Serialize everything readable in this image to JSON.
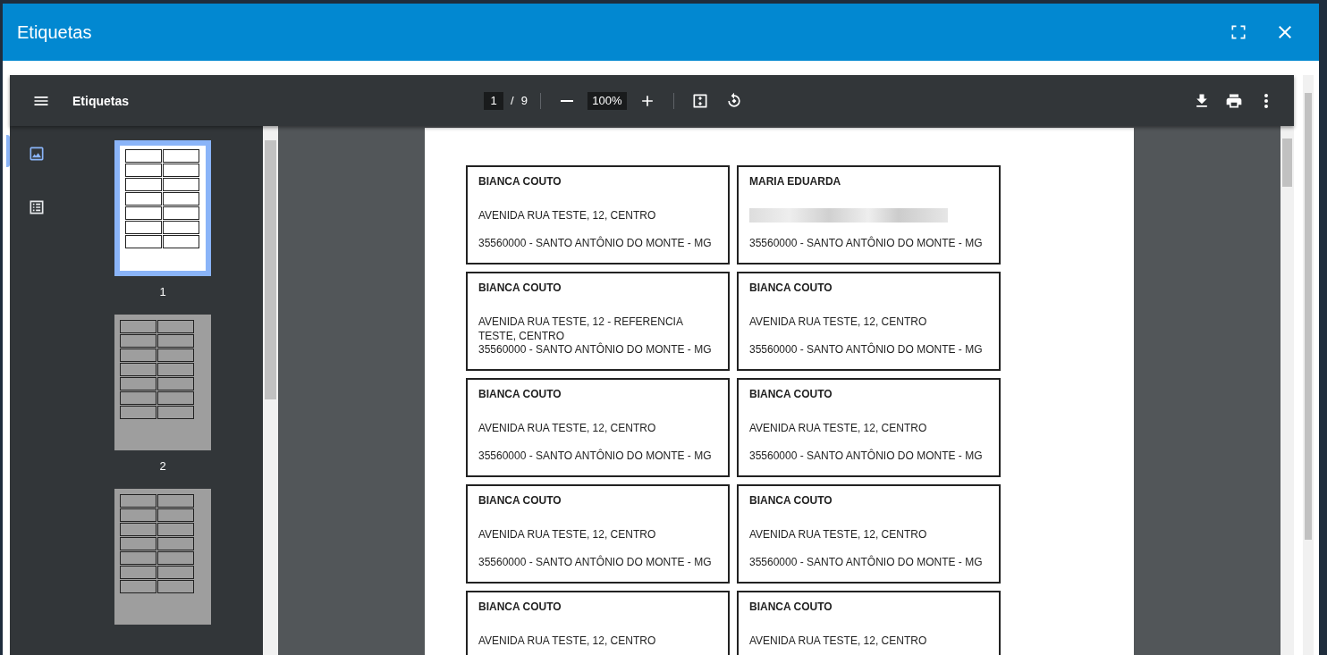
{
  "dialog": {
    "title": "Etiquetas"
  },
  "viewer": {
    "title": "Etiquetas",
    "page": "1",
    "page_separator": "/",
    "page_count": "9",
    "zoom": "100%"
  },
  "sidebar_tabs": [
    {
      "kind": "thumbnails",
      "selected": true
    },
    {
      "kind": "outline",
      "selected": false
    }
  ],
  "thumbnails": [
    {
      "label": "1",
      "selected": true
    },
    {
      "label": "2",
      "selected": false
    },
    {
      "selected": false
    }
  ],
  "labels": [
    {
      "name": "BIANCA COUTO",
      "address": "AVENIDA RUA TESTE, 12, CENTRO",
      "city": "35560000 - SANTO ANTÔNIO DO MONTE - MG",
      "redacted": false
    },
    {
      "name": "MARIA EDUARDA",
      "redacted": true,
      "city": "35560000 - SANTO ANTÔNIO DO MONTE - MG"
    },
    {
      "name": "BIANCA COUTO",
      "address": "AVENIDA RUA TESTE, 12 - REFERENCIA TESTE, CENTRO",
      "city": "35560000 - SANTO ANTÔNIO DO MONTE - MG",
      "redacted": false
    },
    {
      "name": "BIANCA COUTO",
      "address": "AVENIDA RUA TESTE, 12, CENTRO",
      "city": "35560000 - SANTO ANTÔNIO DO MONTE - MG",
      "redacted": false
    },
    {
      "name": "BIANCA COUTO",
      "address": "AVENIDA RUA TESTE, 12, CENTRO",
      "city": "35560000 - SANTO ANTÔNIO DO MONTE - MG",
      "redacted": false
    },
    {
      "name": "BIANCA COUTO",
      "address": "AVENIDA RUA TESTE, 12, CENTRO",
      "city": "35560000 - SANTO ANTÔNIO DO MONTE - MG",
      "redacted": false
    },
    {
      "name": "BIANCA COUTO",
      "address": "AVENIDA RUA TESTE, 12, CENTRO",
      "city": "35560000 - SANTO ANTÔNIO DO MONTE - MG",
      "redacted": false
    },
    {
      "name": "BIANCA COUTO",
      "address": "AVENIDA RUA TESTE, 12, CENTRO",
      "city": "35560000 - SANTO ANTÔNIO DO MONTE - MG",
      "redacted": false
    },
    {
      "name": "BIANCA COUTO",
      "address": "AVENIDA RUA TESTE, 12, CENTRO",
      "redacted": false
    },
    {
      "name": "BIANCA COUTO",
      "address": "AVENIDA RUA TESTE, 12, CENTRO",
      "redacted": false
    }
  ]
}
